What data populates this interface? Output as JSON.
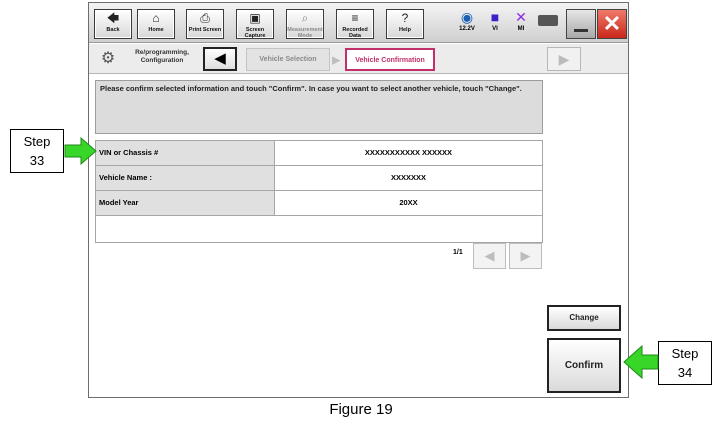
{
  "toolbar": {
    "buttons": [
      {
        "label": "Back",
        "icon": "back-arrow-icon"
      },
      {
        "label": "Home",
        "icon": "home-icon"
      },
      {
        "label": "Print Screen",
        "icon": "printer-icon"
      },
      {
        "label": "Screen Capture",
        "icon": "camera-icon"
      },
      {
        "label": "Measurement Mode",
        "icon": "measurement-icon"
      },
      {
        "label": "Recorded Data",
        "icon": "recorded-data-icon"
      },
      {
        "label": "Help",
        "icon": "help-icon"
      }
    ],
    "status": [
      {
        "label": "12.2V",
        "icon": "car-battery-icon"
      },
      {
        "label": "VI",
        "icon": "vi-icon"
      },
      {
        "label": "MI",
        "icon": "mi-cross-icon"
      }
    ]
  },
  "breadcrumb": {
    "root_label": "Re/programming, Configuration",
    "steps": [
      "Vehicle Selection",
      "Vehicle Confirmation"
    ],
    "active_step": "Vehicle Confirmation"
  },
  "message": "Please confirm selected information and touch \"Confirm\". In case you want to select another vehicle, touch \"Change\".",
  "table": {
    "rows": [
      {
        "label": "VIN or Chassis #",
        "value": "XXXXXXXXXXX XXXXXX"
      },
      {
        "label": "Vehicle Name :",
        "value": "XXXXXXX"
      },
      {
        "label": "Model Year",
        "value": "20XX"
      }
    ]
  },
  "pagination": {
    "text": "1/1"
  },
  "actions": {
    "change": "Change",
    "confirm": "Confirm"
  },
  "callouts": {
    "step33": {
      "word": "Step",
      "number": "33"
    },
    "step34": {
      "word": "Step",
      "number": "34"
    }
  },
  "caption": "Figure 19",
  "colors": {
    "accent": "#c2306a",
    "arrow": "#39d62a",
    "close": "#d0382a"
  }
}
